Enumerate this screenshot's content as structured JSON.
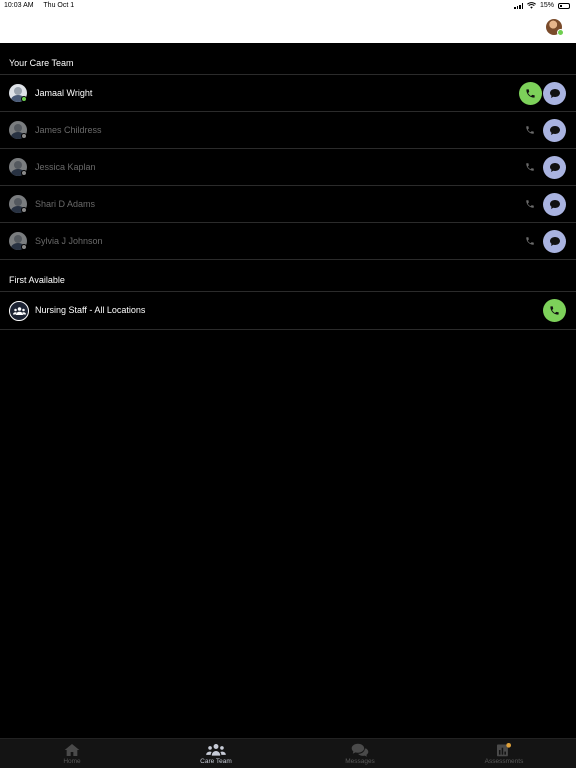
{
  "status_bar": {
    "time": "10:03 AM",
    "date": "Thu Oct 1",
    "battery": "15%"
  },
  "care_team": {
    "title": "Your Care Team",
    "members": [
      {
        "name": "Jamaal Wright",
        "available": true
      },
      {
        "name": "James Childress",
        "available": false
      },
      {
        "name": "Jessica Kaplan",
        "available": false
      },
      {
        "name": "Shari D Adams",
        "available": false
      },
      {
        "name": "Sylvia J Johnson",
        "available": false
      }
    ]
  },
  "first_available": {
    "title": "First Available",
    "group_name": "Nursing Staff - All Locations"
  },
  "tabs": [
    {
      "label": "Home",
      "icon": "home-icon",
      "active": false
    },
    {
      "label": "Care Team",
      "icon": "care-team-icon",
      "active": true
    },
    {
      "label": "Messages",
      "icon": "messages-icon",
      "active": false
    },
    {
      "label": "Assessments",
      "icon": "assessments-icon",
      "active": false
    }
  ],
  "colors": {
    "call_green": "#7dd15a",
    "message_lavender": "#a9b3e0",
    "background": "#000000"
  }
}
